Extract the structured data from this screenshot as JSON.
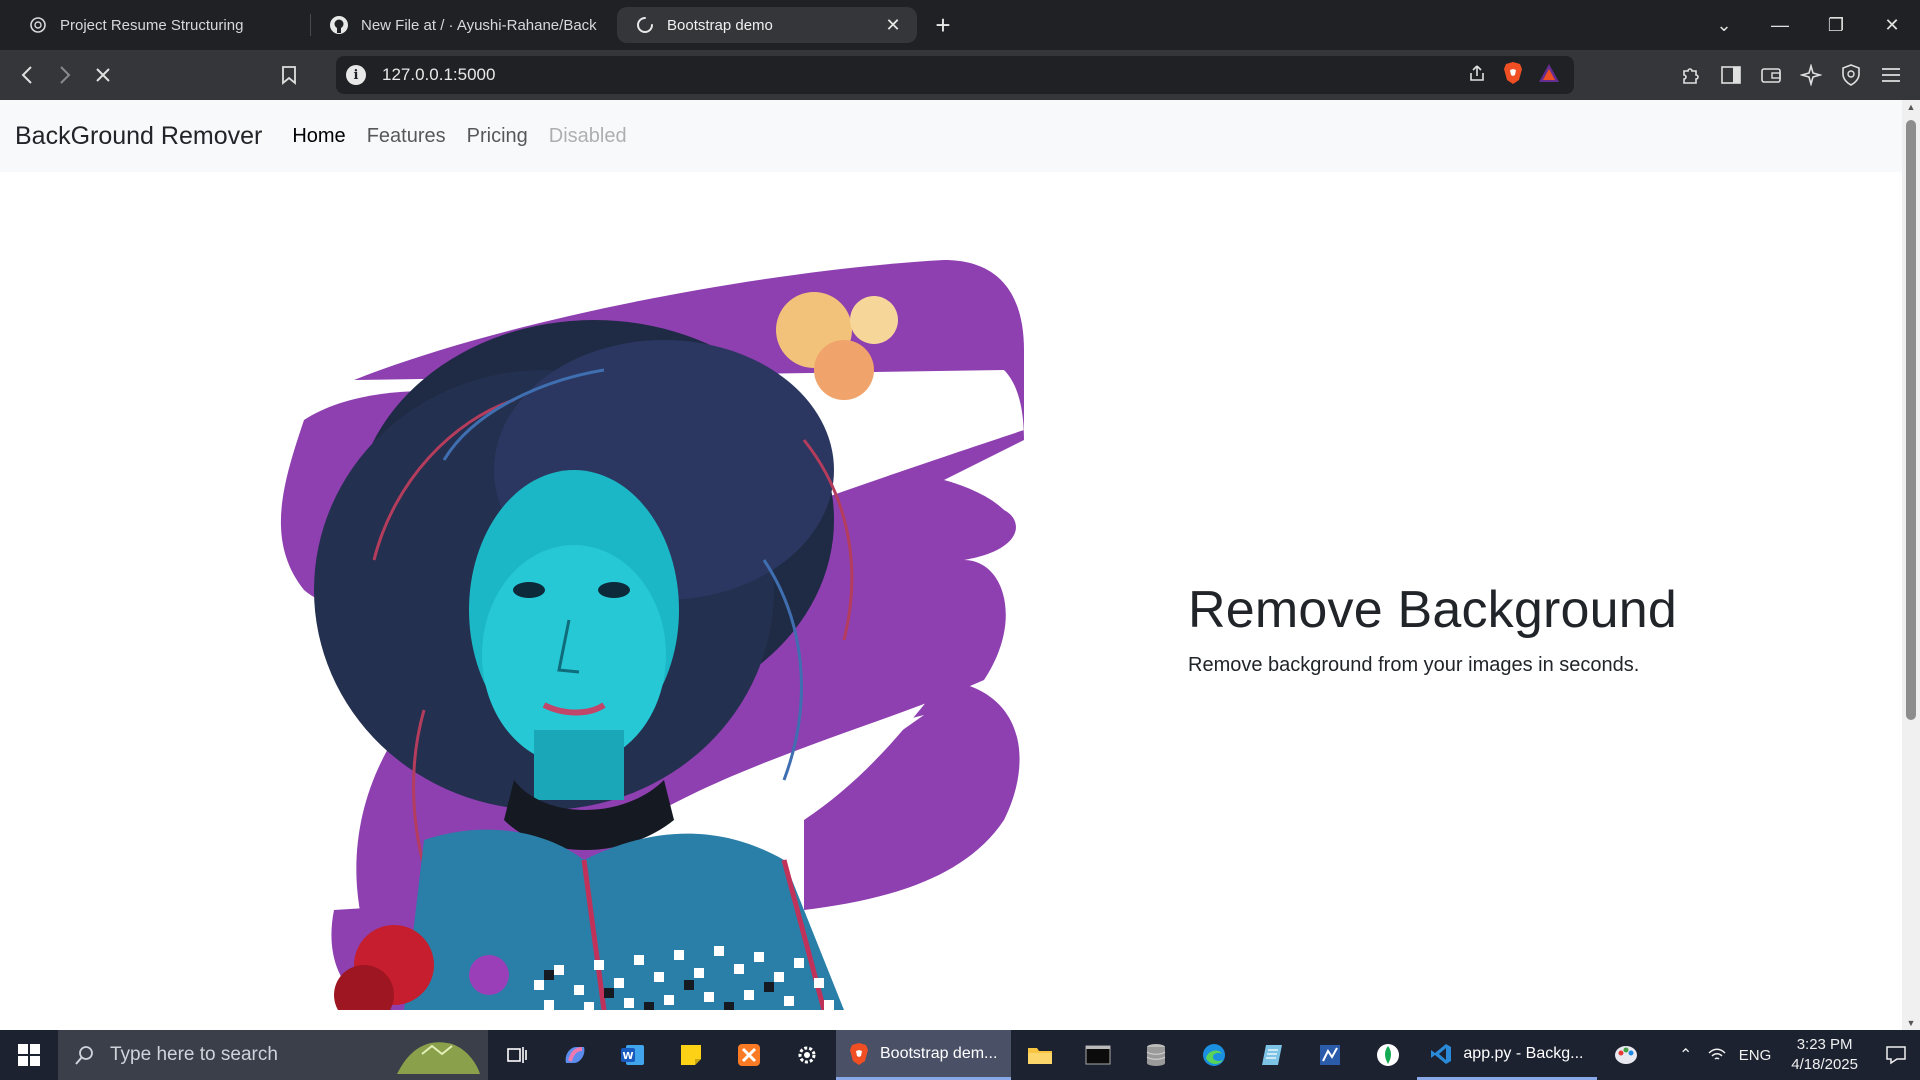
{
  "browser": {
    "tabs": [
      {
        "title": "Project Resume Structuring",
        "icon": "openai-icon",
        "active": false
      },
      {
        "title": "New File at / · Ayushi-Rahane/Backg",
        "icon": "github-icon",
        "active": false
      },
      {
        "title": "Bootstrap demo",
        "icon": "loading-icon",
        "active": true
      }
    ],
    "address": "127.0.0.1:5000"
  },
  "site": {
    "brand": "BackGround Remover",
    "nav": [
      {
        "label": "Home",
        "state": "active"
      },
      {
        "label": "Features",
        "state": "normal"
      },
      {
        "label": "Pricing",
        "state": "normal"
      },
      {
        "label": "Disabled",
        "state": "disabled"
      }
    ],
    "hero": {
      "title": "Remove Background",
      "subtitle": "Remove background from your images in seconds."
    }
  },
  "taskbar": {
    "search_placeholder": "Type here to search",
    "active_app": "Bootstrap dem...",
    "vscode_app": "app.py - Backg...",
    "language": "ENG",
    "time": "3:23 PM",
    "date": "4/18/2025"
  },
  "colors": {
    "accent_purple": "#8e3fb0",
    "navbar_bg": "#f8f9fa",
    "browser_bg": "#202124"
  }
}
